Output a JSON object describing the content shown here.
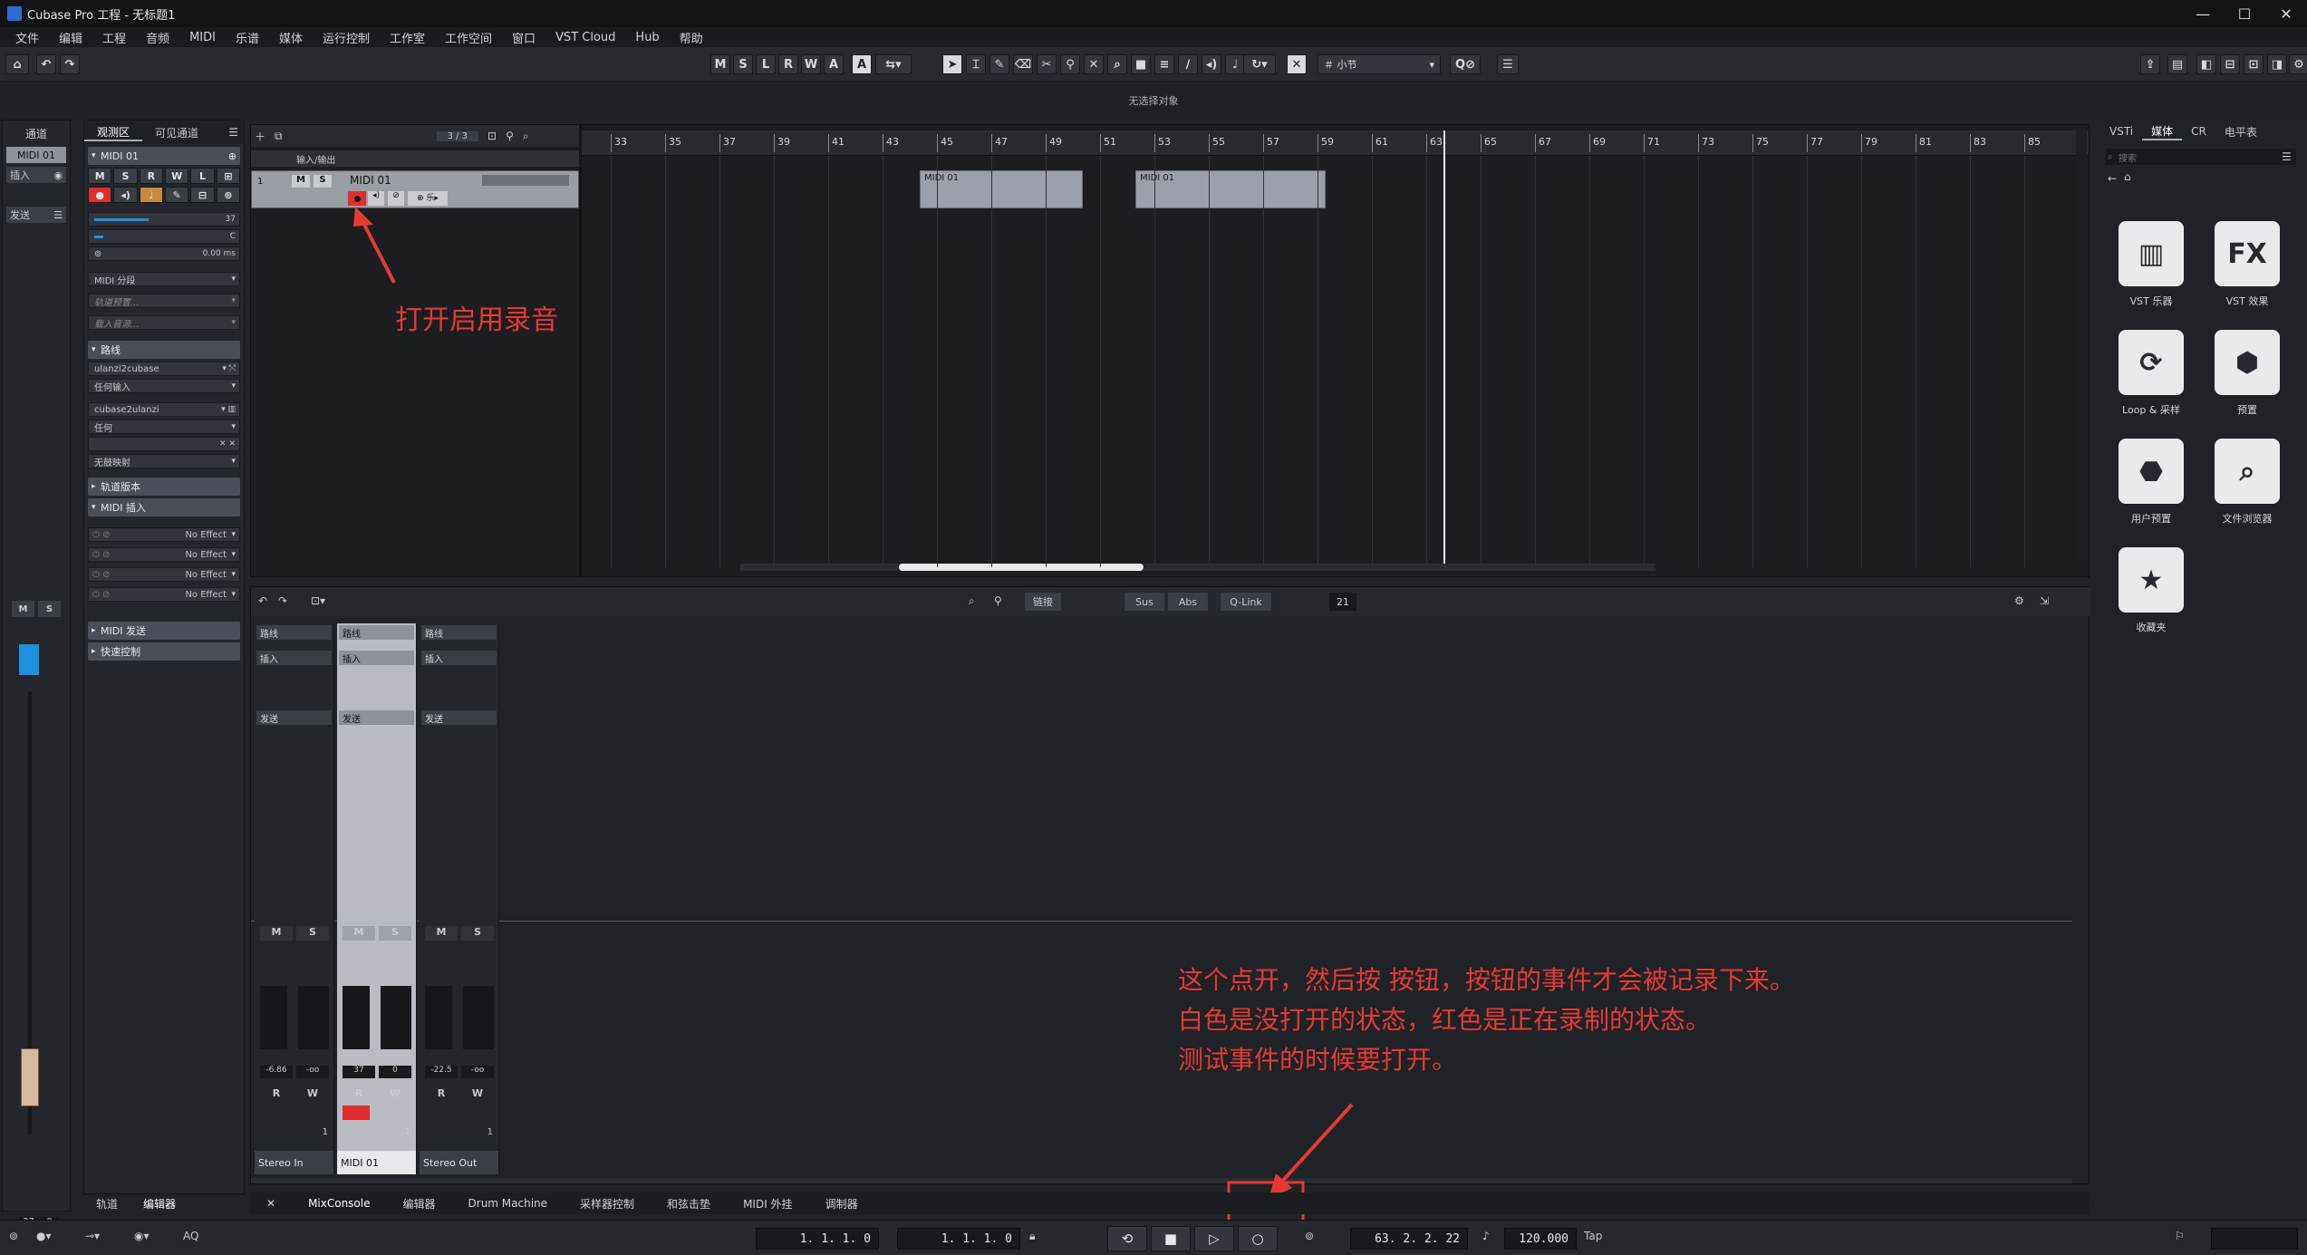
{
  "window": {
    "title": "Cubase Pro 工程 - 无标题1",
    "controls": [
      "—",
      "☐",
      "✕"
    ]
  },
  "menu": [
    "文件",
    "编辑",
    "工程",
    "音频",
    "MIDI",
    "乐谱",
    "媒体",
    "运行控制",
    "工作室",
    "工作空间",
    "窗口",
    "VST Cloud",
    "Hub",
    "帮助"
  ],
  "toolbar": {
    "modes": [
      "M",
      "S",
      "L",
      "R",
      "W",
      "A"
    ],
    "snap_label": "小节",
    "no_selection": "无选择对象"
  },
  "inspector": {
    "tabs": [
      "通道",
      "观测区",
      "可见通道"
    ],
    "track_name": "MIDI 01",
    "volume": "37",
    "pan": "C",
    "delay": "0.00 ms",
    "midi_split": "MIDI 分段",
    "sections": {
      "routing": "路线",
      "track_versions": "轨道版本",
      "midi_inserts": "MIDI 插入",
      "midi_sends": "MIDI 发送",
      "quick_controls": "快速控制"
    },
    "input_device": "ulanzi2cubase",
    "input_channel": "任何输入",
    "output_device": "cubase2ulanzi",
    "output_channel": "任何",
    "no_map": "无鼓映射",
    "no_effect": "No Effect",
    "placeholder_preset": "轨道预置...",
    "placeholder_sound": "载入音源...",
    "strip_labels": {
      "insert": "插入",
      "send": "发送"
    }
  },
  "project": {
    "counter": "3 / 3",
    "folder_label": "输入/输出",
    "track": {
      "num": "1",
      "name": "MIDI 01",
      "m": "M",
      "s": "S"
    },
    "ruler": [
      "33",
      "35",
      "37",
      "39",
      "41",
      "43",
      "45",
      "47",
      "49",
      "51",
      "53",
      "55",
      "57",
      "59",
      "61",
      "63",
      "65",
      "67",
      "69",
      "71",
      "73",
      "75",
      "77",
      "79",
      "81",
      "83",
      "85"
    ],
    "parts": [
      "MIDI 01",
      "MIDI 01"
    ],
    "annotation_record": "打开启用录音"
  },
  "mixer": {
    "toolbar": {
      "link": "链接",
      "sus": "Sus",
      "abs": "Abs",
      "qlink": "Q-Link",
      "num": "21"
    },
    "strips": [
      {
        "name": "Stereo In",
        "route": "路线",
        "insert": "插入",
        "send": "发送",
        "vol": "-6.86",
        "pan": "-oo",
        "ch": "1"
      },
      {
        "name": "MIDI 01",
        "route": "路线",
        "insert": "插入",
        "send": "发送",
        "vol": "37",
        "pan": "0",
        "ch": "1"
      },
      {
        "name": "Stereo Out",
        "route": "路线",
        "insert": "插入",
        "send": "发送",
        "vol": "-22.5",
        "pan": "-oo",
        "ch": "1"
      }
    ],
    "annotation_lines": [
      "这个点开，然后按 按钮，按钮的事件才会被记录下来。",
      "白色是没打开的状态，红色是正在录制的状态。",
      "测试事件的时候要打开。"
    ]
  },
  "left_zone_tabs": [
    "轨道",
    "编辑器"
  ],
  "bottom_tabs": [
    "MixConsole",
    "编辑器",
    "Drum Machine",
    "采样器控制",
    "和弦击垫",
    "MIDI 外挂",
    "调制器"
  ],
  "media": {
    "tabs": [
      "VSTi",
      "媒体",
      "CR",
      "电平表"
    ],
    "search_placeholder": "搜索",
    "tiles": [
      {
        "label": "VST 乐器",
        "icon": "piano-icon"
      },
      {
        "label": "VST 效果",
        "icon": "fx-icon"
      },
      {
        "label": "Loop & 采样",
        "icon": "loop-icon"
      },
      {
        "label": "预置",
        "icon": "preset-icon"
      },
      {
        "label": "用户预置",
        "icon": "user-preset-icon"
      },
      {
        "label": "文件浏览器",
        "icon": "file-browser-icon"
      },
      {
        "label": "收藏夹",
        "icon": "star-icon"
      }
    ]
  },
  "transport": {
    "aq": "AQ",
    "left_locator": "1. 1. 1.  0",
    "right_locator": "1. 1. 1.  0",
    "position": "63. 2. 2. 22",
    "tempo": "120.000",
    "tap": "Tap"
  },
  "colors": {
    "annotation": "#e53a32",
    "record": "#e02d2d",
    "accent": "#1e90e0"
  }
}
